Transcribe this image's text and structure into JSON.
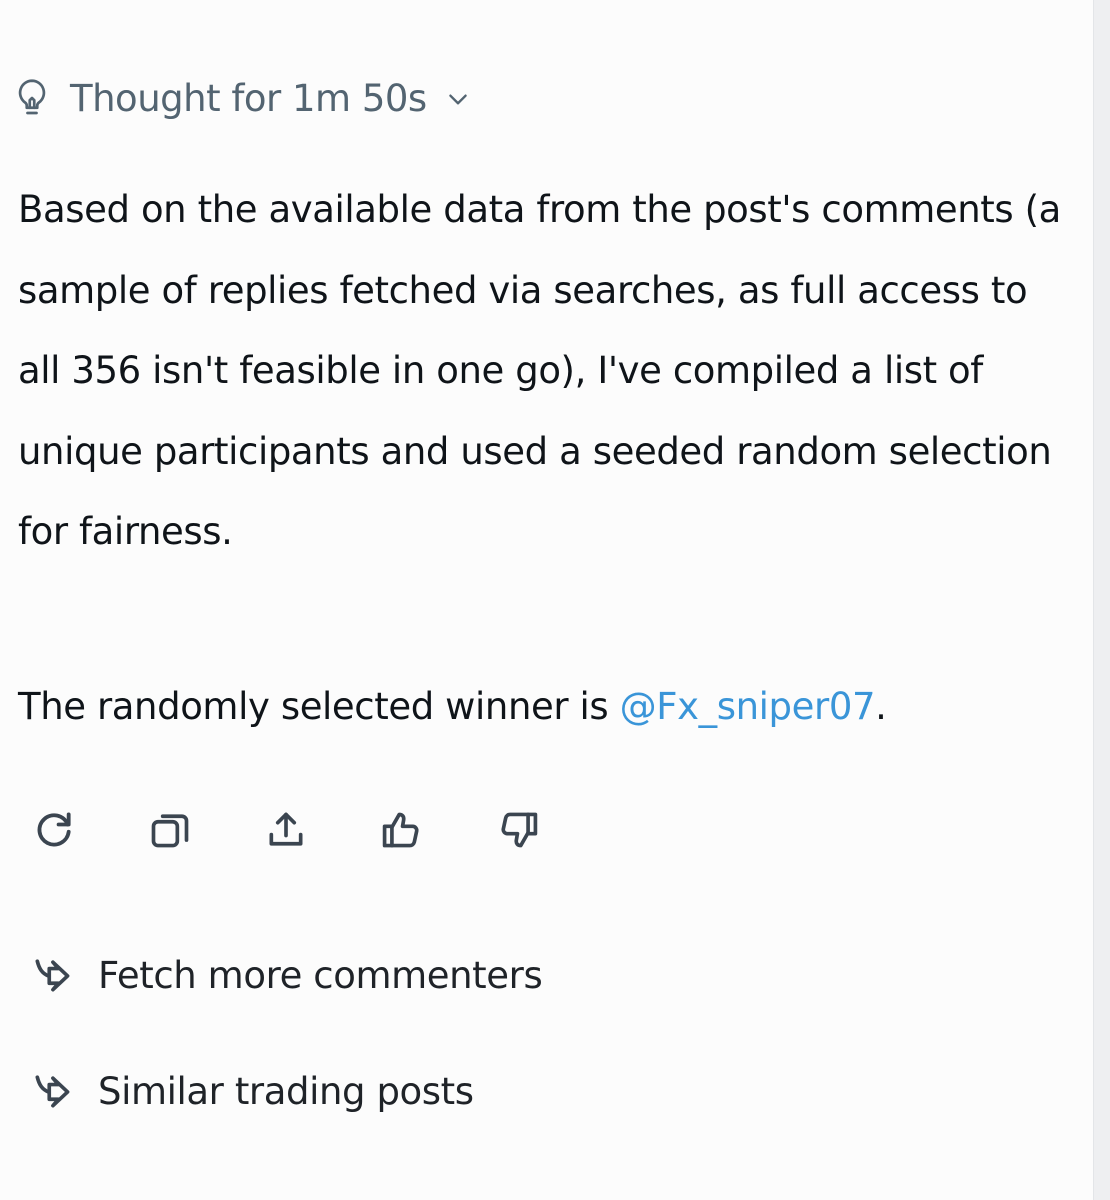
{
  "thinking": {
    "label": "Thought for 1m 50s",
    "icon": "lightbulb-icon",
    "toggle_icon": "chevron-down-icon"
  },
  "response": {
    "paragraph": "Based on the available data from the post's comments (a sample of replies fetched via searches, as full access to all 356 isn't feasible in one go), I've compiled a list of unique participants and used a seeded random selection for fairness.",
    "winner_prefix": "The randomly selected winner is ",
    "winner_handle": "@Fx_sniper07",
    "winner_suffix": "."
  },
  "actions": [
    {
      "name": "regenerate",
      "icon": "refresh-icon"
    },
    {
      "name": "copy",
      "icon": "copy-icon"
    },
    {
      "name": "share",
      "icon": "share-icon"
    },
    {
      "name": "like",
      "icon": "thumbs-up-icon"
    },
    {
      "name": "dislike",
      "icon": "thumbs-down-icon"
    }
  ],
  "suggestions": [
    {
      "label": "Fetch more commenters",
      "icon": "follow-up-arrow-icon"
    },
    {
      "label": "Similar trading posts",
      "icon": "follow-up-arrow-icon"
    }
  ],
  "colors": {
    "text": "#0f1419",
    "muted": "#536471",
    "mention": "#3a95d8",
    "background": "#fcfcfc"
  }
}
